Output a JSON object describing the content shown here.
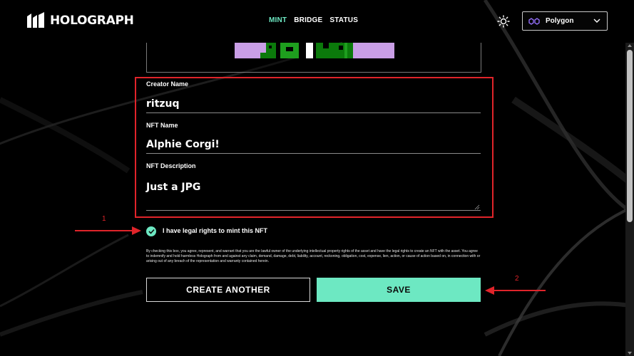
{
  "header": {
    "logo_text": "HOLOGRAPH",
    "nav": [
      {
        "label": "MINT",
        "active": true
      },
      {
        "label": "BRIDGE",
        "active": false
      },
      {
        "label": "STATUS",
        "active": false
      }
    ],
    "theme_icon": "sun-icon",
    "network": {
      "label": "Polygon",
      "icon": "polygon-icon"
    }
  },
  "form": {
    "creator": {
      "label": "Creator Name",
      "value": "ritzuq"
    },
    "nft_name": {
      "label": "NFT Name",
      "value": "Alphie Corgi!"
    },
    "description": {
      "label": "NFT Description",
      "value": "Just a JPG"
    },
    "legal_checkbox": {
      "label": "I have legal rights to mint this NFT",
      "checked": true
    },
    "disclaimer": "By checking this box, you agree, represent, and warrant that you are the lawful owner of the underlying intellectual property rights of the asset and have the legal rights to create an NFT with the asset. You agree to indemnify and hold harmless Holograph from and against any claim, demand, damage, debt, liability, account, reckoning, obligation, cost, expense, lien, action, or cause of action based on, in connection with or arising out of any breach of the representation and warranty contained herein.",
    "buttons": {
      "create_another": "CREATE ANOTHER",
      "save": "SAVE"
    }
  },
  "annotations": {
    "step_one": "1",
    "step_two": "2"
  },
  "colors": {
    "accent": "#6de8c2",
    "annotation": "#e0242a",
    "background": "#000000"
  }
}
